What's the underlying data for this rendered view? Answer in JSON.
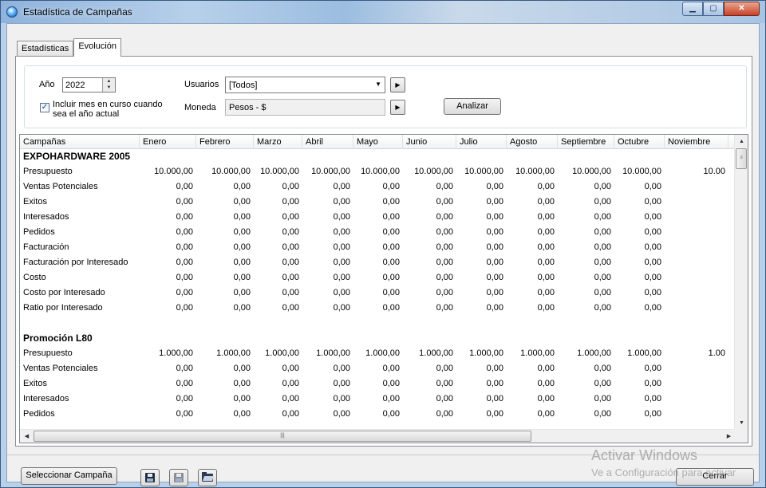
{
  "window": {
    "title": "Estadística de Campañas"
  },
  "tabs": [
    {
      "label": "Estadísticas"
    },
    {
      "label": "Evolución"
    }
  ],
  "filters": {
    "year_label": "Año",
    "year_value": "2022",
    "include_current_month_label": "Incluir mes en curso cuando sea el año actual",
    "include_current_month_checked": true,
    "users_label": "Usuarios",
    "users_value": "[Todos]",
    "currency_label": "Moneda",
    "currency_value": "Pesos - $",
    "analyze_label": "Analizar"
  },
  "grid": {
    "columns": [
      "Campañas",
      "Enero",
      "Febrero",
      "Marzo",
      "Abril",
      "Mayo",
      "Junio",
      "Julio",
      "Agosto",
      "Septiembre",
      "Octubre",
      "Noviembre"
    ],
    "rows": [
      {
        "type": "group",
        "name": "EXPOHARDWARE 2005"
      },
      {
        "name": "Presupuesto",
        "values": [
          "10.000,00",
          "10.000,00",
          "10.000,00",
          "10.000,00",
          "10.000,00",
          "10.000,00",
          "10.000,00",
          "10.000,00",
          "10.000,00",
          "10.000,00",
          "10.00"
        ]
      },
      {
        "name": "Ventas Potenciales",
        "values": [
          "0,00",
          "0,00",
          "0,00",
          "0,00",
          "0,00",
          "0,00",
          "0,00",
          "0,00",
          "0,00",
          "0,00",
          ""
        ]
      },
      {
        "name": "Exitos",
        "values": [
          "0,00",
          "0,00",
          "0,00",
          "0,00",
          "0,00",
          "0,00",
          "0,00",
          "0,00",
          "0,00",
          "0,00",
          ""
        ]
      },
      {
        "name": "Interesados",
        "values": [
          "0,00",
          "0,00",
          "0,00",
          "0,00",
          "0,00",
          "0,00",
          "0,00",
          "0,00",
          "0,00",
          "0,00",
          ""
        ]
      },
      {
        "name": "Pedidos",
        "values": [
          "0,00",
          "0,00",
          "0,00",
          "0,00",
          "0,00",
          "0,00",
          "0,00",
          "0,00",
          "0,00",
          "0,00",
          ""
        ]
      },
      {
        "name": "Facturación",
        "values": [
          "0,00",
          "0,00",
          "0,00",
          "0,00",
          "0,00",
          "0,00",
          "0,00",
          "0,00",
          "0,00",
          "0,00",
          ""
        ]
      },
      {
        "name": "Facturación por Interesado",
        "values": [
          "0,00",
          "0,00",
          "0,00",
          "0,00",
          "0,00",
          "0,00",
          "0,00",
          "0,00",
          "0,00",
          "0,00",
          ""
        ]
      },
      {
        "name": "Costo",
        "values": [
          "0,00",
          "0,00",
          "0,00",
          "0,00",
          "0,00",
          "0,00",
          "0,00",
          "0,00",
          "0,00",
          "0,00",
          ""
        ]
      },
      {
        "name": "Costo por Interesado",
        "values": [
          "0,00",
          "0,00",
          "0,00",
          "0,00",
          "0,00",
          "0,00",
          "0,00",
          "0,00",
          "0,00",
          "0,00",
          ""
        ]
      },
      {
        "name": "Ratio por Interesado",
        "values": [
          "0,00",
          "0,00",
          "0,00",
          "0,00",
          "0,00",
          "0,00",
          "0,00",
          "0,00",
          "0,00",
          "0,00",
          ""
        ]
      },
      {
        "type": "blank"
      },
      {
        "type": "group",
        "name": "Promoción L80"
      },
      {
        "name": "Presupuesto",
        "values": [
          "1.000,00",
          "1.000,00",
          "1.000,00",
          "1.000,00",
          "1.000,00",
          "1.000,00",
          "1.000,00",
          "1.000,00",
          "1.000,00",
          "1.000,00",
          "1.00"
        ]
      },
      {
        "name": "Ventas Potenciales",
        "values": [
          "0,00",
          "0,00",
          "0,00",
          "0,00",
          "0,00",
          "0,00",
          "0,00",
          "0,00",
          "0,00",
          "0,00",
          ""
        ]
      },
      {
        "name": "Exitos",
        "values": [
          "0,00",
          "0,00",
          "0,00",
          "0,00",
          "0,00",
          "0,00",
          "0,00",
          "0,00",
          "0,00",
          "0,00",
          ""
        ]
      },
      {
        "name": "Interesados",
        "values": [
          "0,00",
          "0,00",
          "0,00",
          "0,00",
          "0,00",
          "0,00",
          "0,00",
          "0,00",
          "0,00",
          "0,00",
          ""
        ]
      },
      {
        "name": "Pedidos",
        "values": [
          "0,00",
          "0,00",
          "0,00",
          "0,00",
          "0,00",
          "0,00",
          "0,00",
          "0,00",
          "0,00",
          "0,00",
          ""
        ]
      }
    ]
  },
  "footer": {
    "select_campaign_label": "Seleccionar Campaña",
    "close_label": "Cerrar",
    "icons": [
      "save-icon",
      "save-disabled-icon",
      "open-folder-icon"
    ]
  },
  "watermark": {
    "line1": "Activar Windows",
    "line2": "Ve a Configuración para activar"
  }
}
